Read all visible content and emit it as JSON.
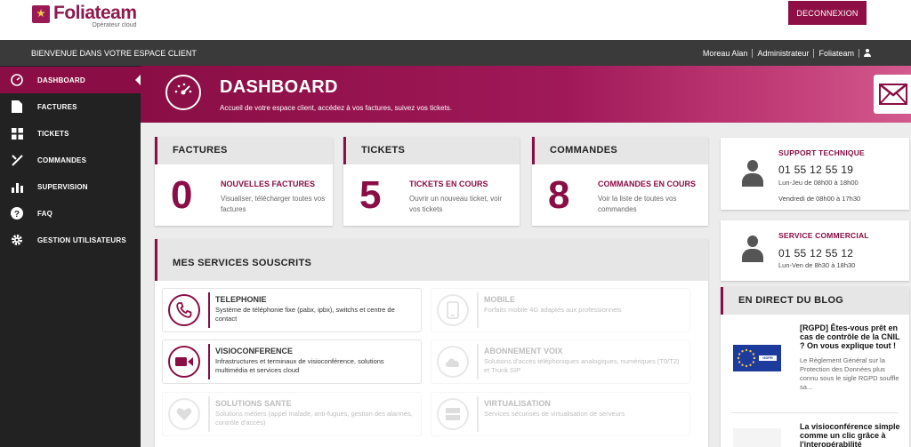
{
  "header": {
    "logo_name": "Foliateam",
    "logo_sub": "Opérateur cloud",
    "logout_label": "DECONNEXION"
  },
  "topbar": {
    "welcome": "BIENVENUE DANS VOTRE ESPACE CLIENT",
    "user": "Moreau Alan",
    "role": "Administrateur",
    "company": "Foliateam"
  },
  "sidebar": {
    "items": [
      {
        "label": "DASHBOARD",
        "icon": "dashboard-icon"
      },
      {
        "label": "FACTURES",
        "icon": "file-icon"
      },
      {
        "label": "TICKETS",
        "icon": "grid-icon"
      },
      {
        "label": "COMMANDES",
        "icon": "tools-icon"
      },
      {
        "label": "SUPERVISION",
        "icon": "bar-chart-icon"
      },
      {
        "label": "FAQ",
        "icon": "question-icon"
      },
      {
        "label": "GESTION UTILISATEURS",
        "icon": "gear-icon"
      }
    ]
  },
  "hero": {
    "title": "DASHBOARD",
    "subtitle": "Accueil de votre espace client, accédez à vos factures, suivez vos tickets."
  },
  "stats": [
    {
      "header": "FACTURES",
      "count": "0",
      "title": "NOUVELLES FACTURES",
      "desc": "Visualiser, télécharger toutes vos factures"
    },
    {
      "header": "TICKETS",
      "count": "5",
      "title": "TICKETS EN COURS",
      "desc": "Ouvrir un nouveau ticket, voir vos tickets"
    },
    {
      "header": "COMMANDES",
      "count": "8",
      "title": "COMMANDES EN COURS",
      "desc": "Voir la liste de toutes vos commandes"
    }
  ],
  "services": {
    "header": "MES SERVICES SOUSCRITS",
    "items": [
      {
        "title": "TELEPHONIE",
        "desc": "Système de téléphonie fixe (pabx, ipbx), switchs et centre de contact",
        "icon": "phone-icon",
        "active": true
      },
      {
        "title": "MOBILE",
        "desc": "Forfaits mobile 4G adaptés aux professionnels",
        "icon": "mobile-icon",
        "active": false
      },
      {
        "title": "VISIOCONFERENCE",
        "desc": "Infrastructures et terminaux de visioconférence, solutions multimédia et services cloud",
        "icon": "video-camera-icon",
        "active": true
      },
      {
        "title": "ABONNEMENT VOIX",
        "desc": "Solutions d'accès téléphoniques analogiques, numériques (T0/T2) et Trunk SIP",
        "icon": "cloud-icon",
        "active": false
      },
      {
        "title": "SOLUTIONS SANTE",
        "desc": "Solutions métiers (appel malade, anti-fugues, gestion des alarmes, contrôle d'accès)",
        "icon": "heart-icon",
        "active": false
      },
      {
        "title": "VIRTUALISATION",
        "desc": "Services sécurisés de virtualisation de serveurs",
        "icon": "server-icon",
        "active": false
      }
    ]
  },
  "support": {
    "title": "SUPPORT TECHNIQUE",
    "phone": "01 55 12 55 19",
    "hours1": "Lun-Jeu de 08h00 à 18h00",
    "hours2": "Vendredi de 08h00 à 17h30"
  },
  "commercial": {
    "title": "SERVICE COMMERCIAL",
    "phone": "01 55 12 55 12",
    "hours": "Lun-Ven de 8h30 à 18h30"
  },
  "blog": {
    "header": "EN DIRECT DU BLOG",
    "post1_title": "[RGPD] Êtes-vous prêt en cas de contrôle de la CNIL ? On vous explique tout !",
    "post1_text": "Le Règlement Général sur la Protection des Données plus connu sous le sigle RGPD souffle sa...",
    "post1_badge": "GDPR",
    "post2_title": "La visioconférence simple comme un clic grâce à l'interopérabilité"
  },
  "colors": {
    "brand": "#8a0e45",
    "sidebar": "#222222",
    "topbar": "#3a3a3a"
  }
}
